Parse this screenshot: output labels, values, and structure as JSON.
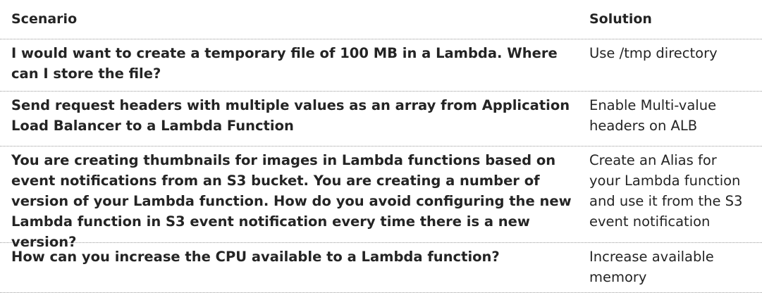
{
  "table": {
    "headers": {
      "scenario": "Scenario",
      "solution": "Solution"
    },
    "rows": [
      {
        "scenario": "I would want to create a temporary file of 100 MB in a Lambda. Where can I store the file?",
        "solution": "Use /tmp directory"
      },
      {
        "scenario": "Send request headers with multiple values as an array from Application Load Balancer to a Lambda Function",
        "solution": "Enable Multi-value headers on ALB"
      },
      {
        "scenario": "You are creating thumbnails for images in Lambda functions based on event notifications from an S3 bucket. You are creating a number of version of your Lambda function. How do you avoid configuring the new Lambda function in S3 event notification every time there is a new version?",
        "solution": "Create an Alias for your Lambda function and use it from the S3 event notification"
      },
      {
        "scenario": "How can you increase the CPU available to a Lambda function?",
        "solution": "Increase available memory"
      }
    ]
  }
}
